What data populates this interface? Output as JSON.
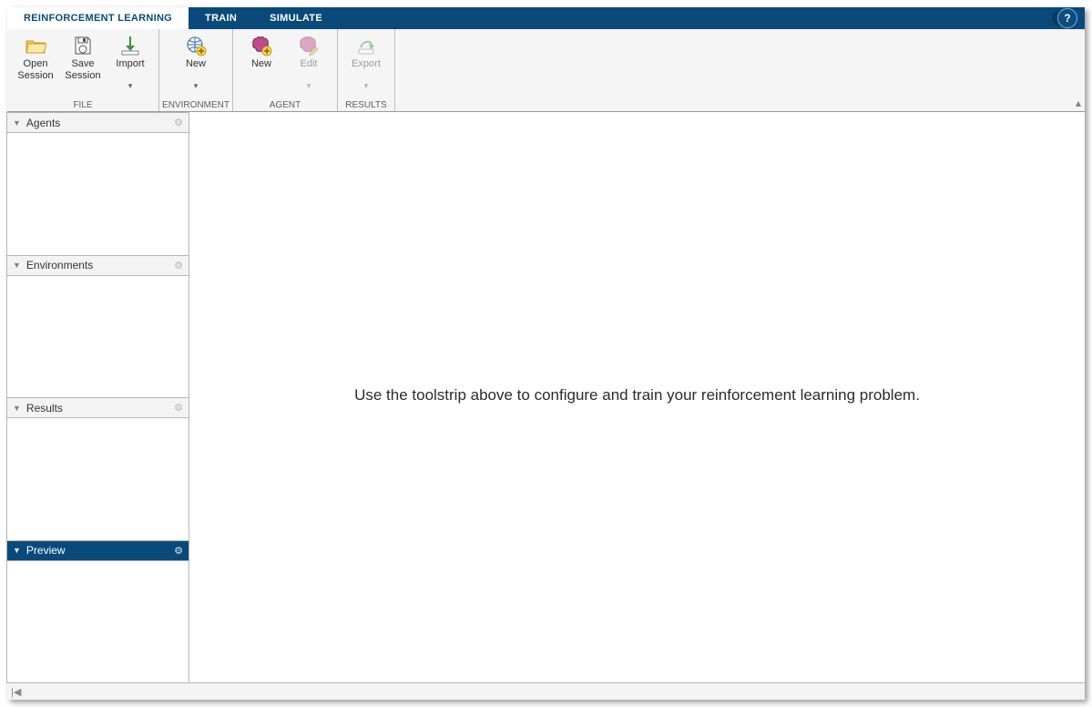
{
  "tabs": {
    "reinforcement_learning": "REINFORCEMENT LEARNING",
    "train": "TRAIN",
    "simulate": "SIMULATE"
  },
  "toolstrip": {
    "file": {
      "label": "FILE",
      "open_session": "Open\nSession",
      "save_session": "Save\nSession",
      "import": "Import"
    },
    "environment": {
      "label": "ENVIRONMENT",
      "new": "New"
    },
    "agent": {
      "label": "AGENT",
      "new": "New",
      "edit": "Edit"
    },
    "results": {
      "label": "RESULTS",
      "export": "Export"
    }
  },
  "sidebar": {
    "agents": "Agents",
    "environments": "Environments",
    "results": "Results",
    "preview": "Preview"
  },
  "main_hint": "Use the toolstrip above to configure and train your reinforcement learning problem.",
  "help_tooltip": "?"
}
